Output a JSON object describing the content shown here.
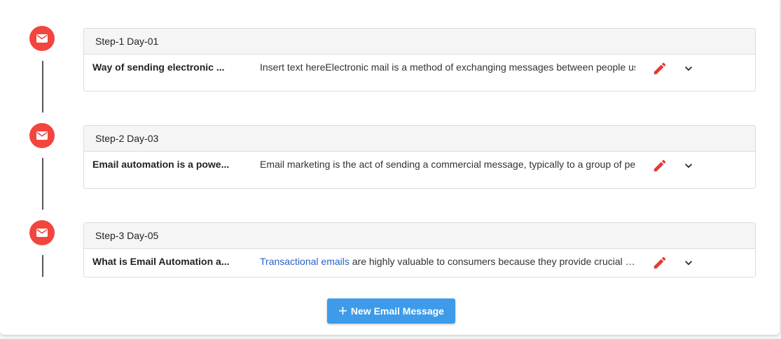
{
  "steps": [
    {
      "header": "Step-1 Day-01",
      "subject": "Way of sending electronic ...",
      "preview_link": "",
      "preview_text": "Insert text hereElectronic mail is a method of exchanging messages between people using electronic devices."
    },
    {
      "header": "Step-2 Day-03",
      "subject": "Email automation is a powe...",
      "preview_link": "",
      "preview_text": "Email marketing is the act of sending a commercial message, typically to a group of people, using email."
    },
    {
      "header": "Step-3 Day-05",
      "subject": "What is Email Automation a...",
      "preview_link": "Transactional emails",
      "preview_text": " are highly valuable to consumers because they provide crucial information."
    }
  ],
  "new_button": {
    "icon": "+",
    "label": "New Email Message"
  },
  "colors": {
    "timeline_icon": "#f2453d",
    "edit_icon": "#e53935",
    "button": "#3d9be9",
    "link": "#2962c8"
  }
}
